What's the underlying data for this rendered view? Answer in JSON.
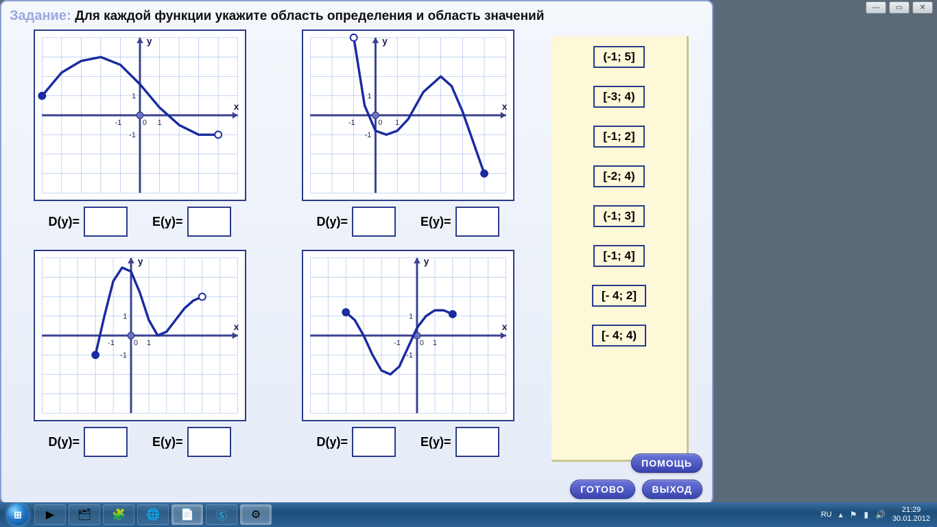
{
  "task": {
    "label": "Задание:",
    "text": "Для каждой функции укажите область определения и область значений"
  },
  "labels": {
    "domain": "D(y)=",
    "range": "E(y)=",
    "x": "x",
    "y": "y",
    "tick_neg1": "-1",
    "tick_1": "1",
    "zero": "0"
  },
  "options": [
    "(-1; 5]",
    "[-3; 4)",
    "[-1; 2]",
    "[-2; 4)",
    "(-1; 3]",
    "[-1; 4]",
    "[- 4; 2]",
    "[- 4; 4)"
  ],
  "buttons": {
    "help": "ПОМОЩЬ",
    "done": "ГОТОВО",
    "exit": "ВЫХОД"
  },
  "chart_data": [
    {
      "type": "line",
      "xlabel": "x",
      "ylabel": "y",
      "xlim": [
        -5,
        5
      ],
      "ylim": [
        -4,
        4
      ],
      "series": [
        {
          "name": "f1",
          "points": [
            [
              -5,
              1
            ],
            [
              -4,
              2.2
            ],
            [
              -3,
              2.8
            ],
            [
              -2,
              3
            ],
            [
              -1,
              2.6
            ],
            [
              0,
              1.6
            ],
            [
              1,
              0.4
            ],
            [
              2,
              -0.5
            ],
            [
              3,
              -1
            ],
            [
              4,
              -1
            ]
          ],
          "left_closed": true,
          "right_closed": false
        }
      ]
    },
    {
      "type": "line",
      "xlabel": "x",
      "ylabel": "y",
      "xlim": [
        -3,
        6
      ],
      "ylim": [
        -4,
        4
      ],
      "series": [
        {
          "name": "f2",
          "points": [
            [
              -1,
              4
            ],
            [
              -0.5,
              0.5
            ],
            [
              0,
              -0.8
            ],
            [
              0.5,
              -1
            ],
            [
              1,
              -0.8
            ],
            [
              1.5,
              -0.2
            ],
            [
              2.2,
              1.2
            ],
            [
              3,
              2
            ],
            [
              3.5,
              1.5
            ],
            [
              4,
              0.2
            ],
            [
              5,
              -3
            ]
          ],
          "left_closed": false,
          "right_closed": true
        }
      ]
    },
    {
      "type": "line",
      "xlabel": "x",
      "ylabel": "y",
      "xlim": [
        -5,
        6
      ],
      "ylim": [
        -4,
        4
      ],
      "series": [
        {
          "name": "f3",
          "points": [
            [
              -2,
              -1
            ],
            [
              -1.5,
              1
            ],
            [
              -1,
              2.8
            ],
            [
              -0.5,
              3.5
            ],
            [
              0,
              3.3
            ],
            [
              0.5,
              2.2
            ],
            [
              1,
              0.8
            ],
            [
              1.5,
              0
            ],
            [
              2,
              0.2
            ],
            [
              2.5,
              0.8
            ],
            [
              3,
              1.4
            ],
            [
              3.5,
              1.8
            ],
            [
              4,
              2
            ]
          ],
          "left_closed": true,
          "right_closed": false
        }
      ]
    },
    {
      "type": "line",
      "xlabel": "x",
      "ylabel": "y",
      "xlim": [
        -6,
        5
      ],
      "ylim": [
        -4,
        4
      ],
      "series": [
        {
          "name": "f4",
          "points": [
            [
              -4,
              1.2
            ],
            [
              -3.5,
              0.8
            ],
            [
              -3,
              0
            ],
            [
              -2.5,
              -1
            ],
            [
              -2,
              -1.8
            ],
            [
              -1.5,
              -2
            ],
            [
              -1,
              -1.6
            ],
            [
              -0.5,
              -0.6
            ],
            [
              0,
              0.4
            ],
            [
              0.5,
              1
            ],
            [
              1,
              1.3
            ],
            [
              1.5,
              1.3
            ],
            [
              2,
              1.1
            ]
          ],
          "left_closed": true,
          "right_closed": true
        }
      ]
    }
  ],
  "taskbar": {
    "lang": "RU",
    "time": "21:29",
    "date": "30.01.2012"
  }
}
